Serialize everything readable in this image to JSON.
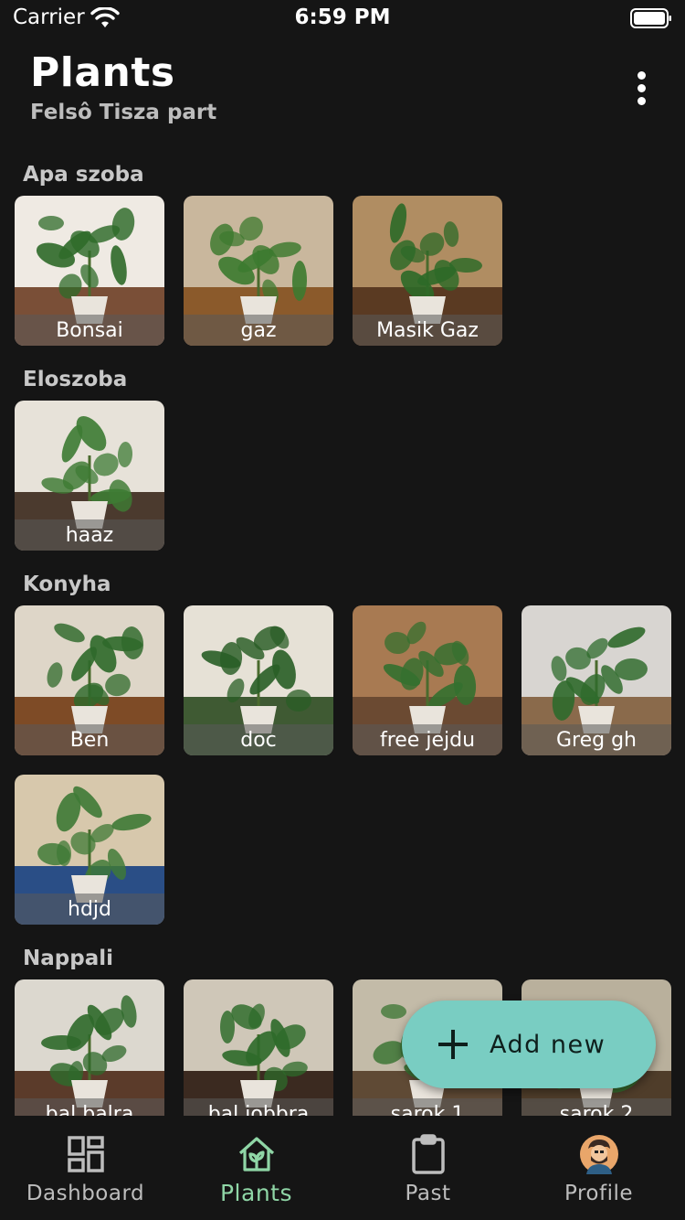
{
  "status_bar": {
    "carrier": "Carrier",
    "time": "6:59 PM"
  },
  "header": {
    "title": "Plants",
    "subtitle": "Felsô Tisza part",
    "more_icon": "more-vertical-icon"
  },
  "rooms": [
    {
      "name": "Apa szoba",
      "plants": [
        {
          "name": "Bonsai"
        },
        {
          "name": "gaz"
        },
        {
          "name": "Masik Gaz"
        }
      ]
    },
    {
      "name": "Eloszoba",
      "plants": [
        {
          "name": "haaz"
        }
      ]
    },
    {
      "name": "Konyha",
      "plants": [
        {
          "name": "Ben"
        },
        {
          "name": "doc"
        },
        {
          "name": "free jejdu"
        },
        {
          "name": "Greg gh"
        },
        {
          "name": "hdjd"
        }
      ]
    },
    {
      "name": "Nappali",
      "plants": [
        {
          "name": "bal balra"
        },
        {
          "name": "bal jobbra"
        },
        {
          "name": "sarok 1"
        },
        {
          "name": "sarok 2"
        }
      ]
    }
  ],
  "fab": {
    "label": "Add new",
    "icon": "plus-icon",
    "color": "#79cdc2"
  },
  "tabs": [
    {
      "label": "Dashboard",
      "icon": "dashboard-icon",
      "active": false
    },
    {
      "label": "Plants",
      "icon": "home-icon",
      "active": true
    },
    {
      "label": "Past",
      "icon": "clipboard-icon",
      "active": false
    },
    {
      "label": "Profile",
      "icon": "avatar-icon",
      "active": false
    }
  ],
  "colors": {
    "background": "#151515",
    "accent": "#8fd6a6",
    "fab": "#79cdc2"
  }
}
